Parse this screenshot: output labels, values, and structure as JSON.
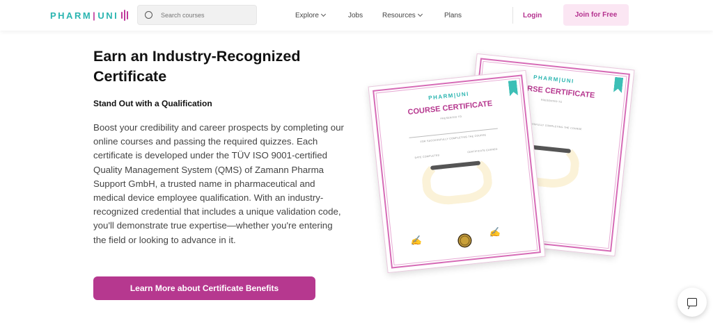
{
  "header": {
    "logo_pharm": "PHARM",
    "logo_bar": "|",
    "logo_uni": "UNI",
    "search_placeholder": "Search courses",
    "nav": [
      {
        "label": "Explore",
        "dropdown": true
      },
      {
        "label": "Jobs",
        "dropdown": false
      },
      {
        "label": "Resources",
        "dropdown": true
      },
      {
        "label": "Plans",
        "dropdown": false
      }
    ],
    "login_label": "Login",
    "join_label": "Join for Free"
  },
  "main": {
    "title": "Earn an Industry-Recognized Certificate",
    "subtitle": "Stand Out with a Qualification",
    "body": "Boost your credibility and career prospects by completing our online courses and passing the required quizzes. Each certificate is developed under the TÜV ISO 9001-certified Quality Management System (QMS) of Zamann Pharma Support GmbH, a trusted name in pharmaceutical and medical device employee qualification. With an industry-recognized credential that includes a unique validation code, you'll demonstrate true expertise—whether you're entering the field or looking to advance in it.",
    "cta_label": "Learn More about Certificate Benefits"
  },
  "certificate": {
    "logo": "PHARM|UNI",
    "heading": "COURSE CERTIFICATE",
    "presented_to": "PRESENTED TO",
    "completing_text": "FOR SUCCESSFULLY COMPLETING THE COURSE",
    "date_label": "DATE COMPLETED",
    "earned_label": "CERTIFICATE EARNED"
  },
  "colors": {
    "brand_magenta": "#b6388f",
    "brand_teal": "#2bb5b0",
    "join_bg": "#fbe6f3"
  },
  "icons": {
    "search": "search-icon",
    "chat": "chat-icon",
    "chevron": "chevron-down-icon"
  }
}
